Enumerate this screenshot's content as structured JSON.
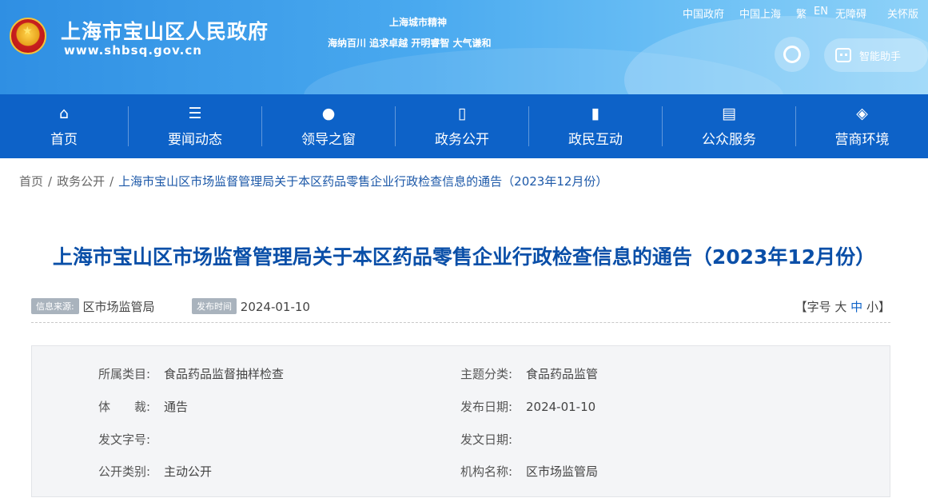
{
  "header": {
    "site_title": "上海市宝山区人民政府",
    "site_url": "www.shbsq.gov.cn",
    "spirit_title": "上海城市精神",
    "spirit_text": "海纳百川 追求卓越 开明睿智 大气谦和",
    "top_links": [
      "中国政府",
      "中国上海",
      "繁",
      "EN",
      "无障碍",
      "关怀版"
    ],
    "assistant_label": "智能助手",
    "emblem_icon": "national-emblem-icon"
  },
  "nav": {
    "items": [
      {
        "label": "首页",
        "icon": "home-icon"
      },
      {
        "label": "要闻动态",
        "icon": "list-icon"
      },
      {
        "label": "领导之窗",
        "icon": "person-icon"
      },
      {
        "label": "政务公开",
        "icon": "document-icon"
      },
      {
        "label": "政民互动",
        "icon": "bookmark-icon"
      },
      {
        "label": "公众服务",
        "icon": "service-icon"
      },
      {
        "label": "营商环境",
        "icon": "layers-icon"
      }
    ],
    "background": "#0d62c8"
  },
  "breadcrumb": {
    "home": "首页",
    "section": "政务公开",
    "current": "上海市宝山区市场监督管理局关于本区药品零售企业行政检查信息的通告（2023年12月份）"
  },
  "article": {
    "title": "上海市宝山区市场监督管理局关于本区药品零售企业行政检查信息的通告（2023年12月份）",
    "source_tag": "信息来源:",
    "source_value": "区市场监管局",
    "date_tag": "发布时间",
    "date_value": "2024-01-10",
    "fontsize": {
      "open": "【字号",
      "large": "大",
      "medium": "中",
      "small": "小",
      "close": "】"
    }
  },
  "info": {
    "category_key": "所属类目:",
    "category_value": "食品药品监督抽样检查",
    "topic_key": "主题分类:",
    "topic_value": "食品药品监管",
    "genre_key": "体　　裁:",
    "genre_value": "通告",
    "pubdate_key": "发布日期:",
    "pubdate_value": "2024-01-10",
    "docno_key": "发文字号:",
    "docno_value": "",
    "docdate_key": "发文日期:",
    "docdate_value": "",
    "opentype_key": "公开类别:",
    "opentype_value": "主动公开",
    "org_key": "机构名称:",
    "org_value": "区市场监管局"
  },
  "colors": {
    "accent": "#0d62c8",
    "title": "#0a4fa8",
    "banner_start": "#2f8fe3",
    "banner_end": "#8fd2f8"
  }
}
